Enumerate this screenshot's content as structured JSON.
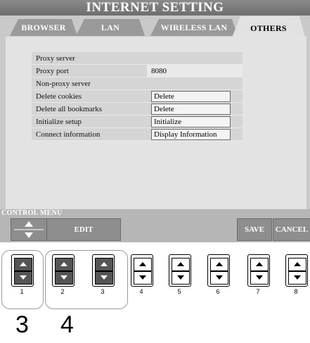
{
  "title": "INTERNET SETTING",
  "tabs": [
    "BROWSER",
    "LAN",
    "WIRELESS LAN",
    "OTHERS"
  ],
  "active_tab": "OTHERS",
  "settings": [
    {
      "label": "Proxy server",
      "value": ""
    },
    {
      "label": "Proxy port",
      "value": "8080"
    },
    {
      "label": "Non-proxy server",
      "value": ""
    },
    {
      "label": "Delete cookies",
      "value": "Delete"
    },
    {
      "label": "Delete all bookmarks",
      "value": "Delete"
    },
    {
      "label": "Initialize setup",
      "value": "Initialize"
    },
    {
      "label": "Connect information",
      "value": "Display Information"
    }
  ],
  "control_menu": {
    "label": "CONTROL MENU",
    "edit": "EDIT",
    "save": "SAVE",
    "cancel": "CANCEL"
  },
  "hardware_buttons": [
    "1",
    "2",
    "3",
    "4",
    "5",
    "6",
    "7",
    "8"
  ],
  "step_labels": [
    "3",
    "4"
  ]
}
